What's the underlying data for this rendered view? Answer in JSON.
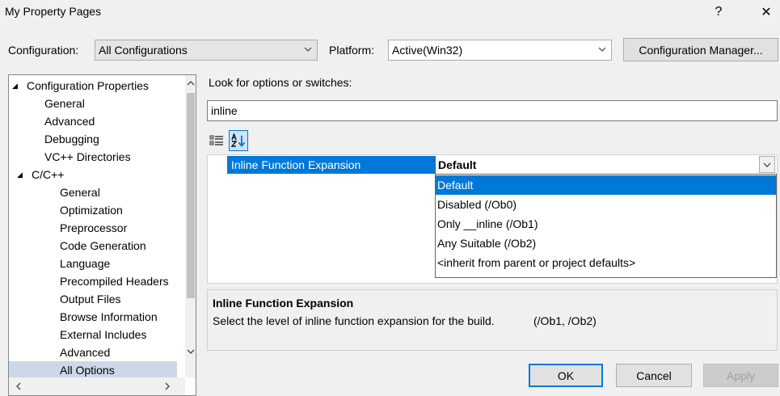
{
  "window": {
    "title": "My Property Pages",
    "help_glyph": "?",
    "close_glyph": "✕"
  },
  "toolbar": {
    "config_label": "Configuration:",
    "config_value": "All Configurations",
    "platform_label": "Platform:",
    "platform_value": "Active(Win32)",
    "config_manager_label": "Configuration Manager..."
  },
  "tree": {
    "items": [
      {
        "label": "Configuration Properties",
        "expander": "◢"
      },
      {
        "label": "General"
      },
      {
        "label": "Advanced"
      },
      {
        "label": "Debugging"
      },
      {
        "label": "VC++ Directories"
      },
      {
        "label": "C/C++",
        "expander": "◢"
      },
      {
        "label": "General"
      },
      {
        "label": "Optimization"
      },
      {
        "label": "Preprocessor"
      },
      {
        "label": "Code Generation"
      },
      {
        "label": "Language"
      },
      {
        "label": "Precompiled Headers"
      },
      {
        "label": "Output Files"
      },
      {
        "label": "Browse Information"
      },
      {
        "label": "External Includes"
      },
      {
        "label": "Advanced"
      },
      {
        "label": "All Options"
      }
    ]
  },
  "search": {
    "label": "Look for options or switches:",
    "value": "inline"
  },
  "grid": {
    "property_name": "Inline Function Expansion",
    "property_value": "Default",
    "options": [
      "Default",
      "Disabled (/Ob0)",
      "Only __inline (/Ob1)",
      "Any Suitable (/Ob2)",
      "<inherit from parent or project defaults>"
    ]
  },
  "description": {
    "title": "Inline Function Expansion",
    "text": "Select the level of inline function expansion for the build.",
    "switches": "(/Ob1, /Ob2)"
  },
  "buttons": {
    "ok": "OK",
    "cancel": "Cancel",
    "apply": "Apply"
  }
}
